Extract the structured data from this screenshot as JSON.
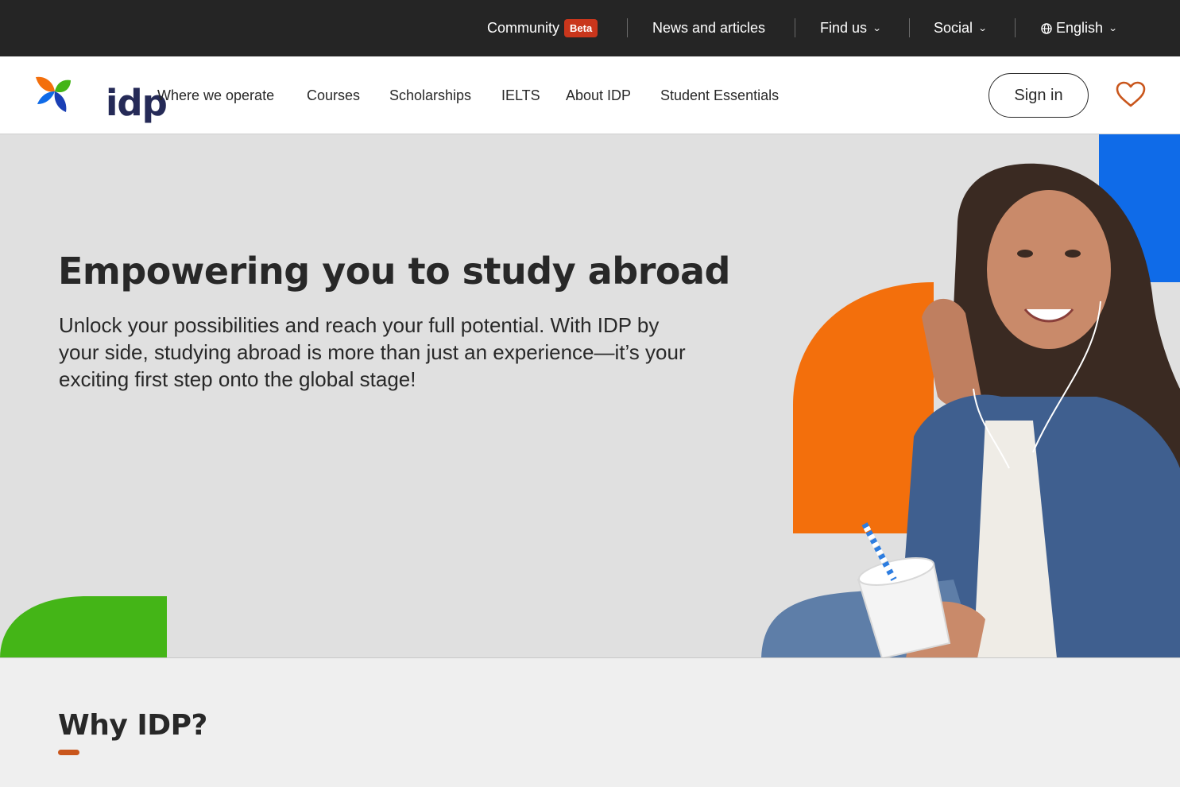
{
  "topbar": {
    "community": "Community",
    "community_badge": "Beta",
    "news": "News and articles",
    "find_us": "Find us",
    "social": "Social",
    "language": "English"
  },
  "nav": {
    "logo_text": "idp",
    "links": [
      "Where we operate",
      "Courses",
      "Scholarships",
      "IELTS",
      "About IDP",
      "Student Essentials"
    ],
    "sign_in": "Sign in"
  },
  "hero": {
    "title": "Empowering you to study abroad",
    "description": "Unlock your possibilities and reach your full potential. With IDP by your side, studying abroad is more than just an experience—it’s your exciting first step onto the global stage!"
  },
  "why": {
    "title": "Why IDP?"
  },
  "colors": {
    "topbar_bg": "#252525",
    "badge": "#c9361c",
    "brand_navy": "#252a57",
    "accent_orange": "#f36f0c",
    "accent_blue": "#0f6be8",
    "accent_green": "#44b517",
    "heart": "#c9561c"
  },
  "icons": [
    "chevron-down-icon",
    "globe-icon",
    "heart-icon",
    "idp-logo"
  ]
}
